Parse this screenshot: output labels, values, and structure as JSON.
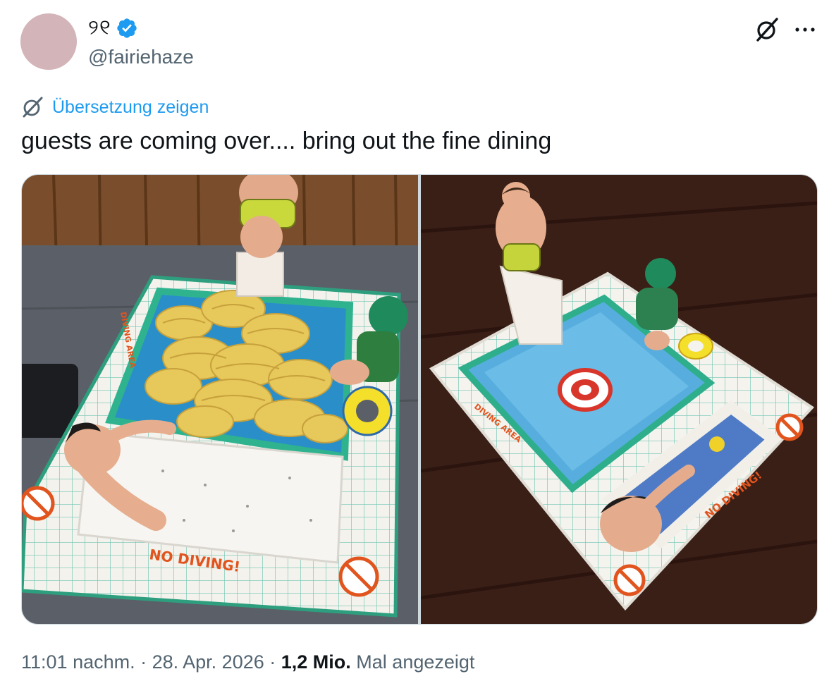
{
  "author": {
    "display_name": "୨୧",
    "handle": "@fairiehaze",
    "verified": true,
    "avatar_color": "#d3b4b8"
  },
  "actions": {
    "grok_icon": "grok-icon",
    "more_icon": "more-icon"
  },
  "translate": {
    "label": "Übersetzung zeigen",
    "icon": "grok-icon"
  },
  "tweet": {
    "text": "guests are coming over.... bring out the fine dining"
  },
  "media": {
    "photo_count": 2,
    "photo_1_signs": {
      "diving_area": "DIVING AREA",
      "no_diving": "NO DIVING!"
    },
    "photo_2_signs": {
      "diving_area": "DIVING AREA",
      "no_diving": "NO DIVING!"
    }
  },
  "meta": {
    "time": "11:01 nachm.",
    "separator": " · ",
    "date": "28. Apr. 2026",
    "views_count": "1,2 Mio.",
    "views_label": "Mal angezeigt"
  },
  "colors": {
    "accent": "#1d9bf0",
    "text_primary": "#0f1419",
    "text_secondary": "#536471",
    "border": "#cfd9de"
  }
}
